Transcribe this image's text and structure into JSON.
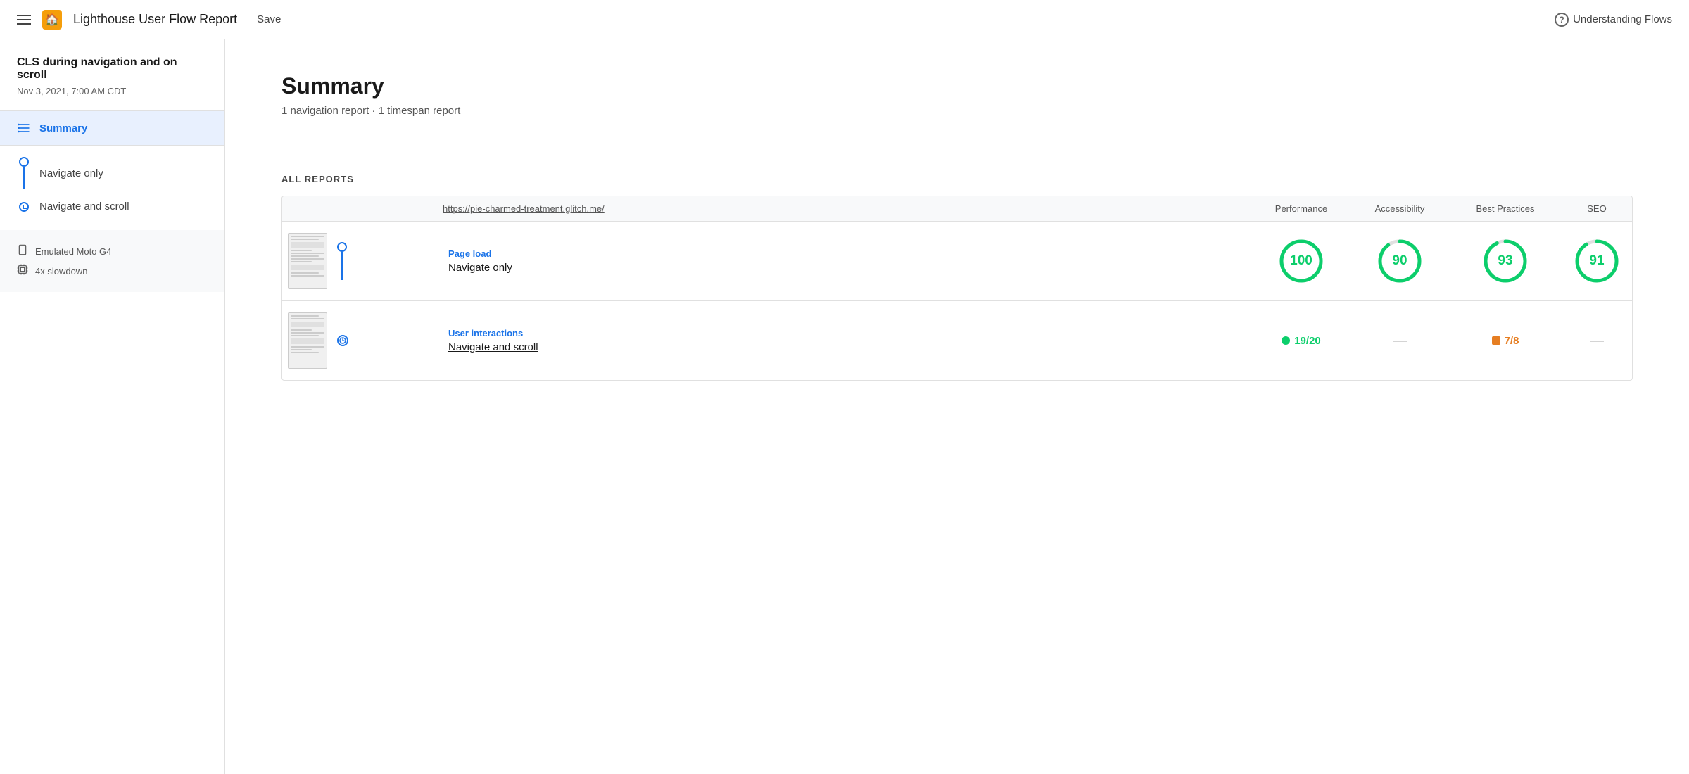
{
  "header": {
    "menu_label": "Menu",
    "logo_emoji": "🏠",
    "title": "Lighthouse User Flow Report",
    "save_label": "Save",
    "understanding_label": "Understanding Flows",
    "help_char": "?"
  },
  "sidebar": {
    "report_title": "CLS during navigation and on scroll",
    "report_date": "Nov 3, 2021, 7:00 AM CDT",
    "summary_label": "Summary",
    "nav_items": [
      {
        "id": "navigate-only",
        "label": "Navigate only",
        "icon": "circle"
      },
      {
        "id": "navigate-scroll",
        "label": "Navigate and scroll",
        "icon": "clock"
      }
    ],
    "meta": [
      {
        "icon": "📱",
        "label": "Emulated Moto G4"
      },
      {
        "icon": "⚙",
        "label": "4x slowdown"
      }
    ]
  },
  "content": {
    "summary_title": "Summary",
    "summary_subtitle": "1 navigation report · 1 timespan report",
    "all_reports_label": "ALL REPORTS",
    "table_headers": {
      "url": "https://pie-charmed-treatment.glitch.me/",
      "performance": "Performance",
      "accessibility": "Accessibility",
      "best_practices": "Best Practices",
      "seo": "SEO"
    },
    "rows": [
      {
        "type": "Page load",
        "name": "Navigate only",
        "icon": "circle",
        "scores": {
          "performance": {
            "type": "circle",
            "value": 100,
            "color": "#0cce6b"
          },
          "accessibility": {
            "type": "circle",
            "value": 90,
            "color": "#0cce6b"
          },
          "best_practices": {
            "type": "circle",
            "value": 93,
            "color": "#0cce6b"
          },
          "seo": {
            "type": "circle",
            "value": 91,
            "color": "#0cce6b"
          }
        }
      },
      {
        "type": "User interactions",
        "name": "Navigate and scroll",
        "icon": "clock",
        "scores": {
          "performance": {
            "type": "badge",
            "dot_color": "#0cce6b",
            "text": "19/20"
          },
          "accessibility": {
            "type": "dash"
          },
          "best_practices": {
            "type": "badge",
            "dot_color": "#e67e22",
            "square": true,
            "text": "7/8"
          },
          "seo": {
            "type": "dash"
          }
        }
      }
    ]
  }
}
